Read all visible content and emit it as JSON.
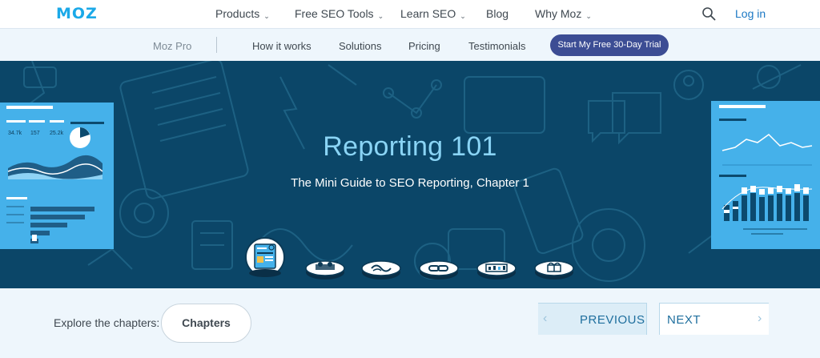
{
  "brand": {
    "logo": "MOZ"
  },
  "topnav": {
    "items": [
      {
        "label": "Products",
        "has_dropdown": true
      },
      {
        "label": "Free SEO Tools",
        "has_dropdown": true
      },
      {
        "label": "Learn SEO",
        "has_dropdown": true
      },
      {
        "label": "Blog",
        "has_dropdown": false
      },
      {
        "label": "Why Moz",
        "has_dropdown": true
      }
    ],
    "chevron": "⌄",
    "search_icon": "search-icon",
    "login_label": "Log in"
  },
  "subnav": {
    "brand": "Moz Pro",
    "items": [
      "How it works",
      "Solutions",
      "Pricing",
      "Testimonials"
    ],
    "cta_label": "Start My Free 30-Day Trial"
  },
  "hero": {
    "title": "Reporting 101",
    "subtitle": "The Mini Guide to SEO Reporting, Chapter 1",
    "left_panel": {
      "stats": [
        "34.7k",
        "157",
        "25.2k"
      ]
    },
    "chapter_icons": [
      "report-chapter-icon",
      "meeting-chapter-icon",
      "link-chapter-icon",
      "chain-chapter-icon",
      "analytics-chapter-icon",
      "gift-chapter-icon"
    ],
    "active_chapter": 0
  },
  "footer": {
    "explore_label": "Explore the chapters:",
    "chapters_button": "Chapters",
    "previous_label": "PREVIOUS",
    "next_label": "NEXT",
    "prev_arrow": "‹",
    "next_arrow": "›"
  },
  "colors": {
    "brand_blue": "#1ba9e8",
    "hero_bg": "#0b4668",
    "hero_title": "#8ad4f5",
    "cta_bg": "#3c4d94",
    "panel_blue": "#45b1ea"
  }
}
